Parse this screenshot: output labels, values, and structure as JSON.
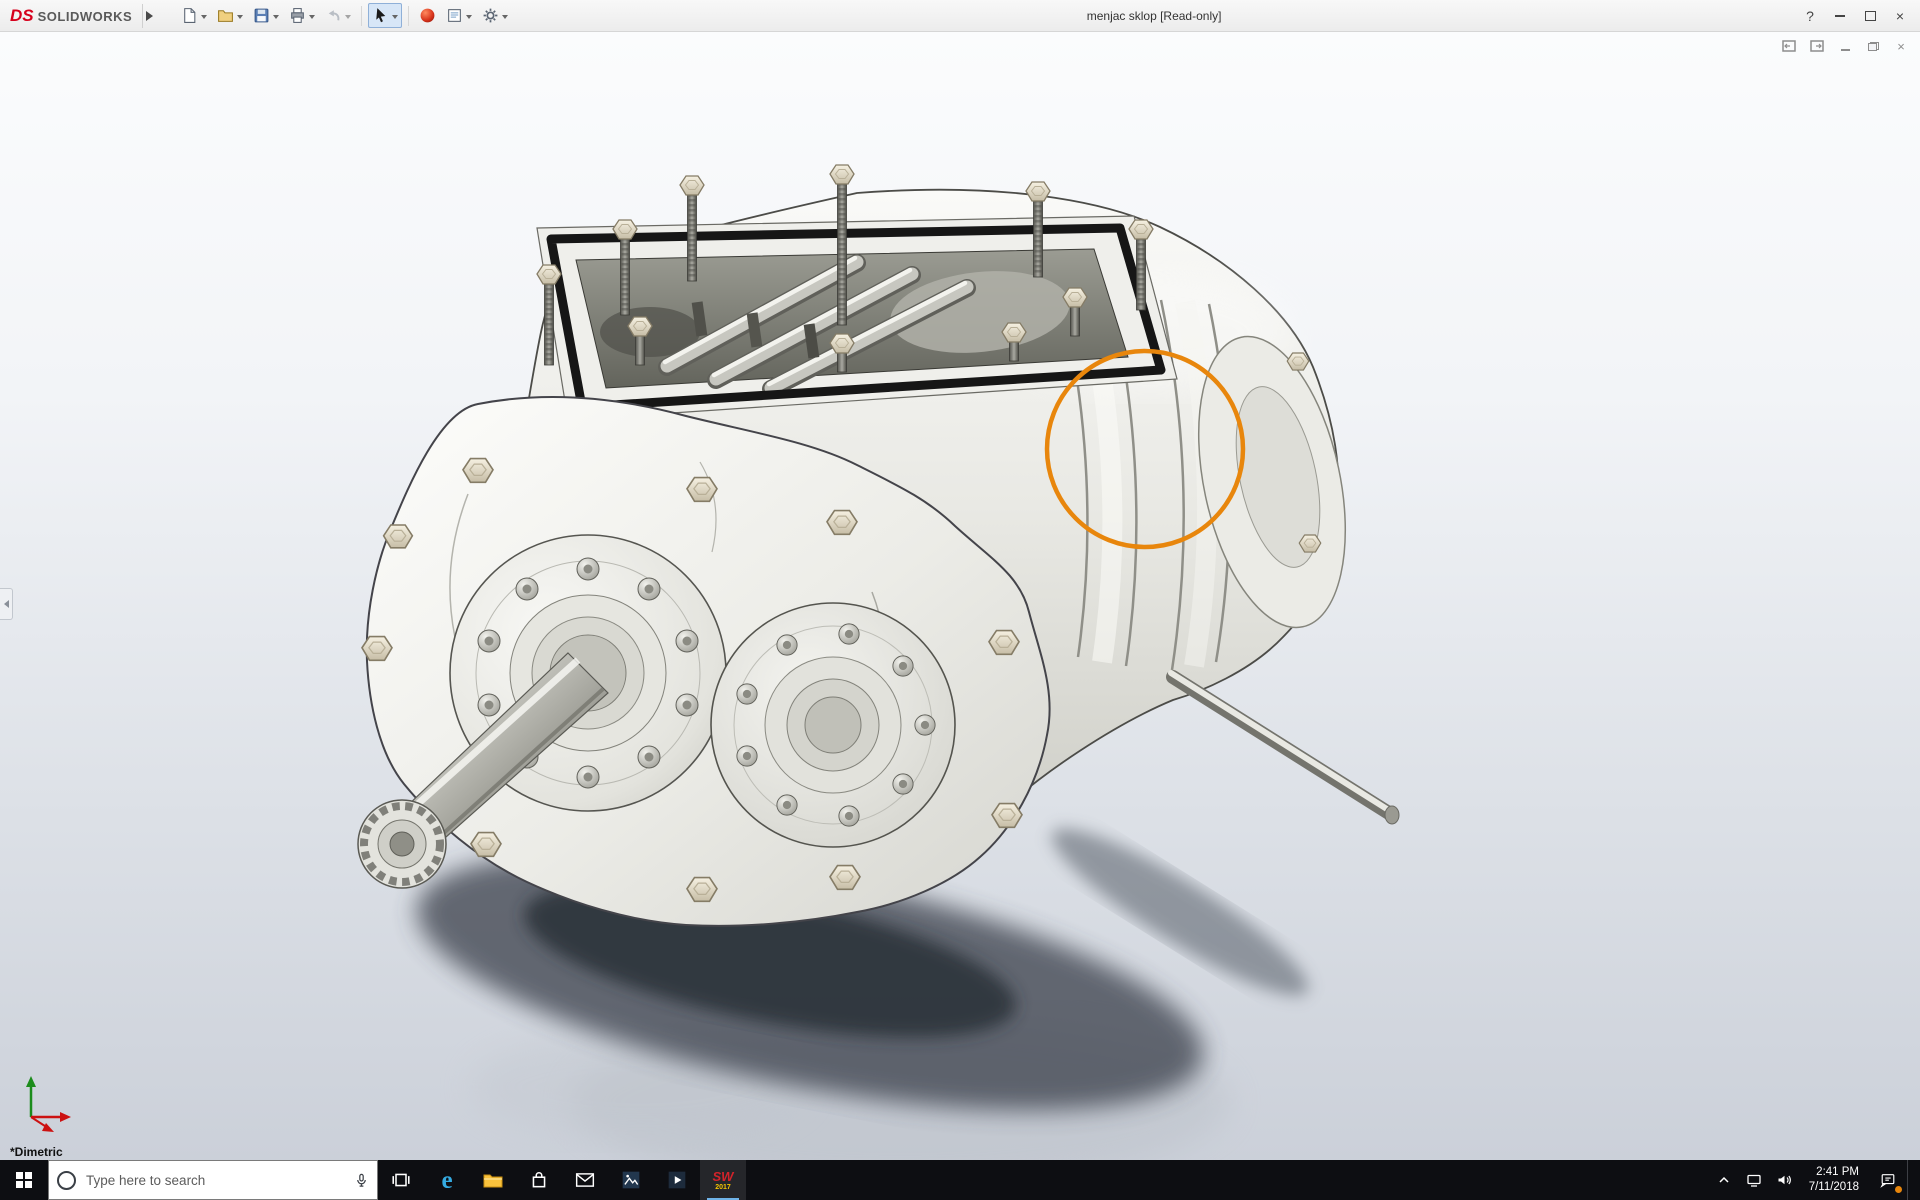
{
  "titlebar": {
    "logo_ds": "DS",
    "brand": "SOLIDWORKS",
    "document_title": "menjac sklop [Read-only]",
    "help_label": "?",
    "close_glyph": "×"
  },
  "toolbar": {
    "icons": [
      "new-document",
      "open",
      "save",
      "print",
      "undo",
      "select",
      "appearance",
      "report",
      "options"
    ]
  },
  "document_window": {
    "controls": [
      "dock-pane-left",
      "dock-pane-right",
      "minimize",
      "restore",
      "close"
    ],
    "close_glyph": "×"
  },
  "viewport": {
    "view_orientation_label": "*Dimetric"
  },
  "annotation": {
    "shape": "circle",
    "color": "#E8860C"
  },
  "taskbar": {
    "search_placeholder": "Type here to search",
    "time": "2:41 PM",
    "date": "7/11/2018",
    "pinned_apps": [
      "task-view",
      "edge",
      "file-explorer",
      "store",
      "mail",
      "photos",
      "movies-tv",
      "solidworks-2017"
    ],
    "running_app": "solidworks-2017",
    "tray_icons": [
      "hidden-icons",
      "network",
      "volume",
      "action-center"
    ],
    "edge_glyph": "e",
    "sw_glyph": "SW",
    "sw_year": "2017"
  }
}
